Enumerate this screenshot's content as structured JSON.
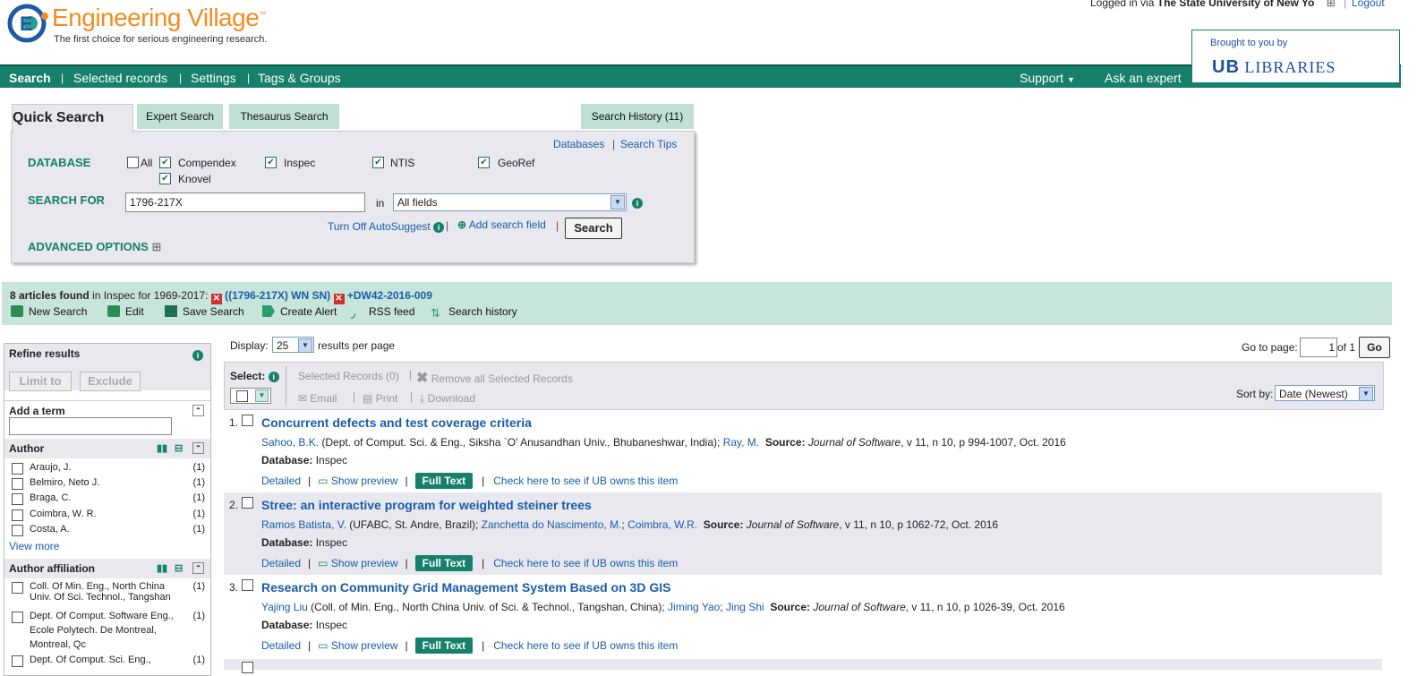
{
  "header": {
    "brand": "Engineering Village",
    "trademark": "™",
    "tagline": "The first choice for serious engineering research.",
    "login_prefix": "Logged in via",
    "login_institution": "The State University of New Yo",
    "logout": "Logout",
    "brought_by": "Brought to you by",
    "library_name": "LIBRARIES",
    "library_logo_text": "UB"
  },
  "nav": {
    "items": [
      "Search",
      "Selected records",
      "Settings",
      "Tags & Groups"
    ],
    "support": "Support",
    "ask": "Ask an expert"
  },
  "search_tabs": {
    "quick": "Quick Search",
    "expert": "Expert Search",
    "thesaurus": "Thesaurus Search",
    "history": "Search History (11)"
  },
  "search_panel": {
    "databases_link": "Databases",
    "tips_link": "Search Tips",
    "database_label": "DATABASE",
    "dbs": {
      "all": "All",
      "compendex": "Compendex",
      "inspec": "Inspec",
      "ntis": "NTIS",
      "georef": "GeoRef",
      "knovel": "Knovel"
    },
    "search_for_label": "SEARCH FOR",
    "query": "1796-217X",
    "in_label": "in",
    "field": "All fields",
    "autosuggest": "Turn Off AutoSuggest",
    "add_field": "Add search field",
    "search_button": "Search",
    "advanced": "ADVANCED OPTIONS"
  },
  "results_bar": {
    "count_text": "8 articles found",
    "context": " in Inspec for 1969-2017: ",
    "term1": "((1796-217X) WN SN)",
    "term2": "+DW42-2016-009",
    "tools": [
      "New Search",
      "Edit",
      "Save Search",
      "Create Alert",
      "RSS feed",
      "Search history"
    ]
  },
  "display": {
    "label": "Display:",
    "value": "25",
    "suffix": "results per page",
    "goto_label": "Go to page:",
    "page": "1",
    "of": "of 1",
    "go": "Go"
  },
  "controls": {
    "select": "Select:",
    "selected_records": "Selected Records (0)",
    "remove_all": "Remove all Selected Records",
    "email": "Email",
    "print": "Print",
    "download": "Download",
    "sort_label": "Sort by:",
    "sort_value": "Date (Newest)"
  },
  "sidebar": {
    "refine": "Refine results",
    "limit": "Limit to",
    "exclude": "Exclude",
    "add_term": "Add a term",
    "author_head": "Author",
    "authors": [
      {
        "name": "Araujo, J.",
        "count": "(1)"
      },
      {
        "name": "Belmiro, Neto J.",
        "count": "(1)"
      },
      {
        "name": "Braga, C.",
        "count": "(1)"
      },
      {
        "name": "Coimbra, W. R.",
        "count": "(1)"
      },
      {
        "name": "Costa, A.",
        "count": "(1)"
      }
    ],
    "view_more": "View more",
    "affil_head": "Author affiliation",
    "affiliations": [
      {
        "line1": "Coll. Of Min. Eng., North China",
        "line2": "Univ. Of Sci. Technol., Tangshan",
        "line3": "",
        "count": "(1)"
      },
      {
        "line1": "Dept. Of Comput. Software Eng.,",
        "line2": "Ecole Polytech. De Montreal,",
        "line3": "Montreal, Qc",
        "count": "(1)"
      },
      {
        "line1": "Dept. Of Comput. Sci. Eng.,",
        "line2": "",
        "line3": "",
        "count": "(1)"
      }
    ]
  },
  "results": [
    {
      "num": "1.",
      "title": "Concurrent defects and test coverage criteria",
      "author1": "Sahoo, B.K.",
      "affil1": " (Dept. of Comput. Sci. & Eng., Siksha `O' Anusandhan Univ., Bhubaneshwar, India); ",
      "author2": "Ray, M.",
      "affil2": "",
      "author3": "",
      "source_label": "Source:",
      "journal": "Journal of Software",
      "citation": ", v 11, n 10, p 994-1007, Oct. 2016",
      "db_label": "Database:",
      "db": "Inspec"
    },
    {
      "num": "2.",
      "title": "Stree: an interactive program for weighted steiner trees",
      "author1": "Ramos Batista, V.",
      "affil1": " (UFABC, St. Andre, Brazil); ",
      "author2": "Zanchetta do Nascimento, M.",
      "affil2": "; ",
      "author3": "Coimbra, W.R.",
      "source_label": "Source:",
      "journal": "Journal of Software",
      "citation": ", v 11, n 10, p 1062-72, Oct. 2016",
      "db_label": "Database:",
      "db": "Inspec"
    },
    {
      "num": "3.",
      "title": "Research on Community Grid Management System Based on 3D GIS",
      "author1": "Yajing Liu",
      "affil1": " (Coll. of Min. Eng., North China Univ. of Sci. & Technol., Tangshan, China); ",
      "author2": "Jiming Yao",
      "affil2": "; ",
      "author3": "Jing Shi",
      "source_label": "Source:",
      "journal": "Journal of Software",
      "citation": ", v 11, n 10, p 1026-39, Oct. 2016",
      "db_label": "Database:",
      "db": "Inspec"
    }
  ],
  "result_actions": {
    "detailed": "Detailed",
    "preview": "Show preview",
    "fulltext": "Full Text",
    "check": "Check here to see if UB owns this item"
  },
  "colors": {
    "brand_green": "#16806a",
    "brand_orange": "#f58a1f",
    "link_blue": "#1a5ca8"
  }
}
